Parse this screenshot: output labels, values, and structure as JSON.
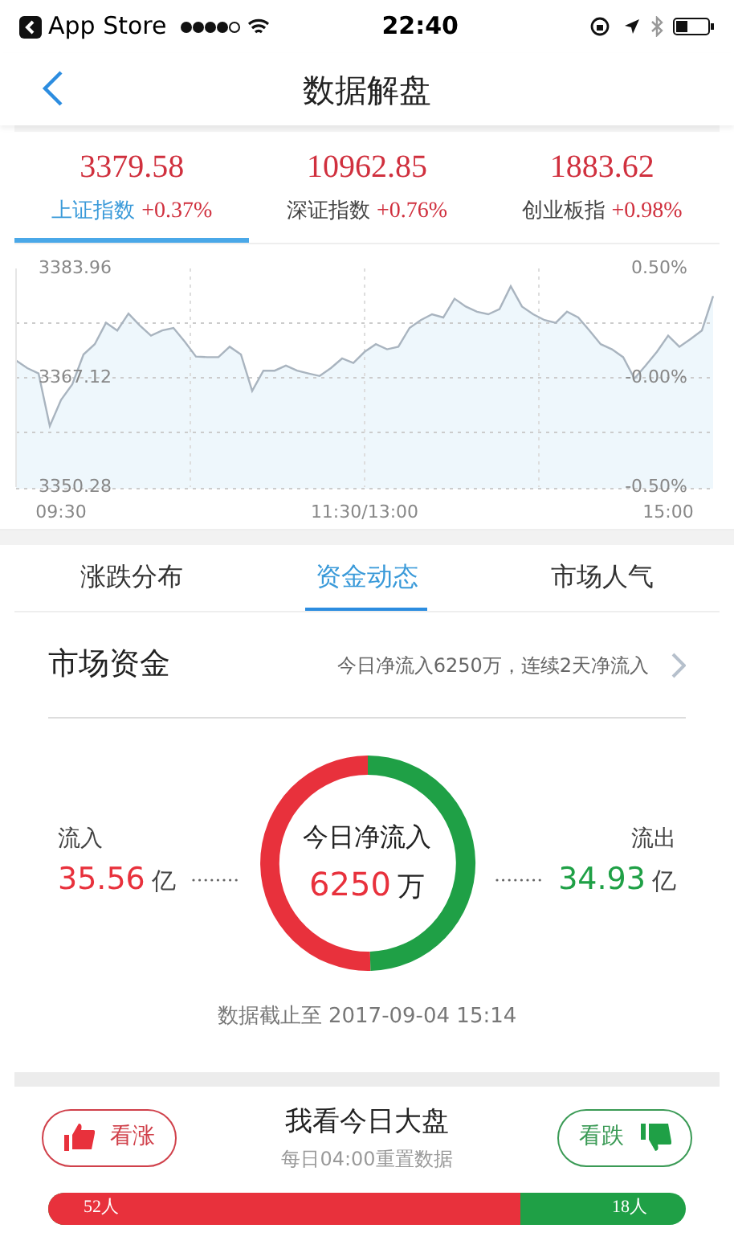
{
  "status_bar": {
    "carrier": "App Store",
    "time": "22:40"
  },
  "nav": {
    "title": "数据解盘"
  },
  "indices": [
    {
      "value": "3379.58",
      "name": "上证指数",
      "change": "+0.37%",
      "selected": true
    },
    {
      "value": "10962.85",
      "name": "深证指数",
      "change": "+0.76%",
      "selected": false
    },
    {
      "value": "1883.62",
      "name": "创业板指",
      "change": "+0.98%",
      "selected": false
    }
  ],
  "intraday": {
    "percent_labels": [
      "0.50%",
      "-0.00%",
      "-0.50%"
    ],
    "chart_data": {
      "type": "area",
      "ylim": [
        3350.28,
        3383.96
      ],
      "yticks": [
        {
          "value": 3383.96,
          "label": "3383.96"
        },
        {
          "value": 3367.12,
          "label": "3367.12"
        },
        {
          "value": 3350.28,
          "label": "3350.28"
        }
      ],
      "categories": [
        null,
        null,
        null,
        null,
        "09:30",
        null,
        null,
        null,
        null,
        null,
        null,
        null,
        null,
        null,
        null,
        null,
        null,
        null,
        null,
        null,
        null,
        null,
        null,
        null,
        null,
        null,
        null,
        null,
        null,
        null,
        null,
        "11:30/13:00",
        null,
        null,
        null,
        null,
        null,
        null,
        null,
        null,
        null,
        null,
        null,
        null,
        null,
        null,
        null,
        null,
        null,
        null,
        null,
        null,
        null,
        null,
        null,
        null,
        null,
        null,
        "15:00",
        null,
        null,
        null,
        null
      ],
      "series": [
        {
          "values": [
            3369.8,
            3368.6,
            3367.8,
            3359.7,
            3363.7,
            3366.1,
            3370.7,
            3372.3,
            3375.6,
            3374.4,
            3377.0,
            3375.2,
            3373.6,
            3374.4,
            3374.8,
            3372.7,
            3370.4,
            3370.3,
            3370.3,
            3371.9,
            3370.7,
            3365.1,
            3368.2,
            3368.2,
            3369.0,
            3368.2,
            3367.8,
            3367.4,
            3368.6,
            3370.1,
            3369.4,
            3371.1,
            3372.3,
            3371.5,
            3371.9,
            3374.8,
            3376.0,
            3376.9,
            3376.4,
            3379.3,
            3378.1,
            3377.3,
            3376.9,
            3377.7,
            3381.2,
            3378.1,
            3376.9,
            3376.0,
            3375.6,
            3377.3,
            3376.4,
            3374.4,
            3372.3,
            3371.5,
            3370.3,
            3367.0,
            3369.0,
            3371.1,
            3373.6,
            3371.9,
            3373.1,
            3374.4,
            3379.7
          ]
        }
      ]
    }
  },
  "tabs": [
    {
      "label": "涨跌分布",
      "selected": false
    },
    {
      "label": "资金动态",
      "selected": true
    },
    {
      "label": "市场人气",
      "selected": false
    }
  ],
  "fund_summary": {
    "title": "市场资金",
    "summary": "今日净流入6250万，连续2天净流入"
  },
  "flow": {
    "inflow": {
      "value": "35.56",
      "unit": "亿"
    },
    "outflow": {
      "value": "34.93",
      "unit": "亿"
    },
    "center_label": "今日净流入",
    "center_value": "6250",
    "center_unit": "万",
    "chart_data": {
      "type": "donut",
      "categories": [
        "流入",
        "流出"
      ],
      "values": [
        50.4,
        49.6
      ]
    },
    "timestamp": "数据截止至 2017-09-04 15:14"
  },
  "vote": {
    "title": "我看今日大盘",
    "subtitle": "每日04:00重置数据",
    "bull_button": "看涨",
    "bear_button": "看跌",
    "bull_count": "52人",
    "bear_count": "18人",
    "level": 0.74
  }
}
